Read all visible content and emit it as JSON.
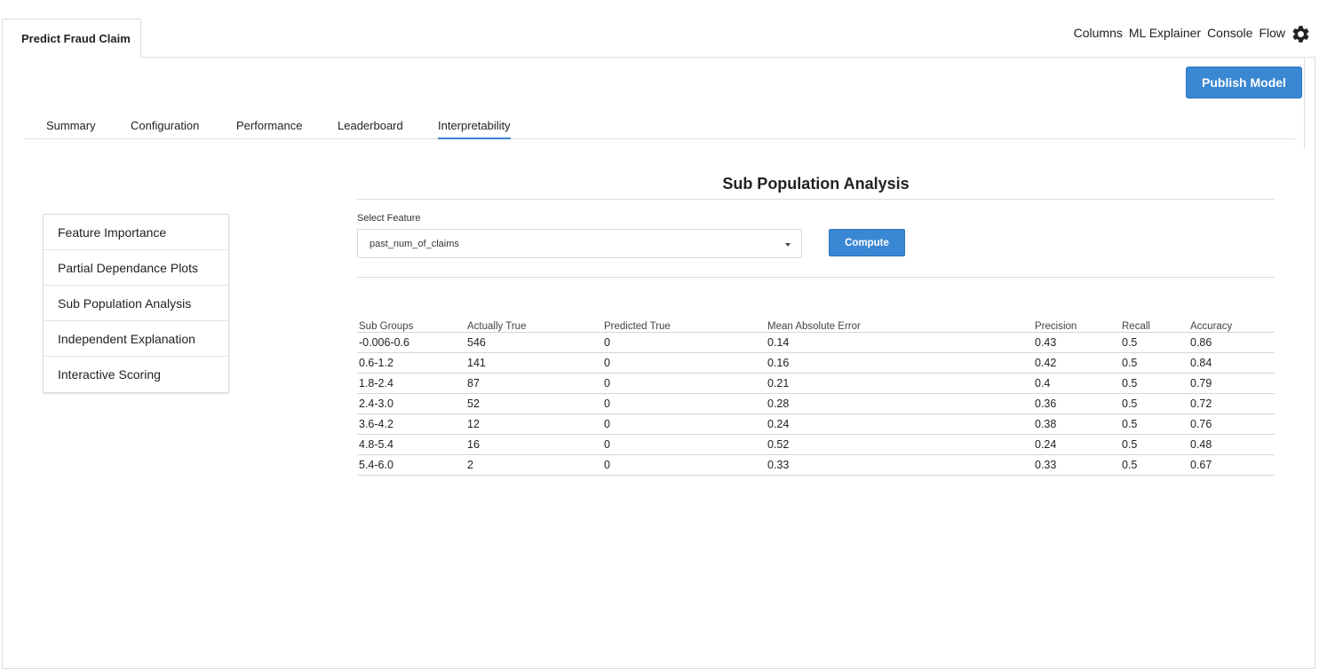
{
  "app": {
    "doc_tab": "Predict Fraud Claim",
    "nav": [
      "Columns",
      "ML Explainer",
      "Console",
      "Flow"
    ],
    "publish_label": "Publish Model"
  },
  "subtabs": [
    {
      "label": "Summary"
    },
    {
      "label": "Configuration"
    },
    {
      "label": "Performance"
    },
    {
      "label": "Leaderboard"
    },
    {
      "label": "Interpretability",
      "active": true
    }
  ],
  "sidemenu": [
    "Feature Importance",
    "Partial Dependance Plots",
    "Sub Population Analysis",
    "Independent Explanation",
    "Interactive Scoring"
  ],
  "analysis": {
    "title": "Sub Population Analysis",
    "select_label": "Select Feature",
    "selected_feature": "past_num_of_claims",
    "compute_label": "Compute"
  },
  "table": {
    "headers": [
      "Sub Groups",
      "Actually True",
      "Predicted True",
      "Mean Absolute Error",
      "Precision",
      "Recall",
      "Accuracy"
    ],
    "rows": [
      [
        "-0.006-0.6",
        "546",
        "0",
        "0.14",
        "0.43",
        "0.5",
        "0.86"
      ],
      [
        "0.6-1.2",
        "141",
        "0",
        "0.16",
        "0.42",
        "0.5",
        "0.84"
      ],
      [
        "1.8-2.4",
        "87",
        "0",
        "0.21",
        "0.4",
        "0.5",
        "0.79"
      ],
      [
        "2.4-3.0",
        "52",
        "0",
        "0.28",
        "0.36",
        "0.5",
        "0.72"
      ],
      [
        "3.6-4.2",
        "12",
        "0",
        "0.24",
        "0.38",
        "0.5",
        "0.76"
      ],
      [
        "4.8-5.4",
        "16",
        "0",
        "0.52",
        "0.24",
        "0.5",
        "0.48"
      ],
      [
        "5.4-6.0",
        "2",
        "0",
        "0.33",
        "0.33",
        "0.5",
        "0.67"
      ]
    ]
  },
  "colors": {
    "accent": "#3a87d3",
    "border": "#dcdcdc"
  },
  "icons": {
    "settings": "gear-icon",
    "dropdown": "caret-down-icon"
  }
}
